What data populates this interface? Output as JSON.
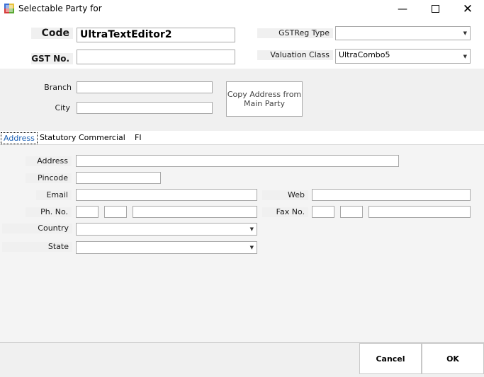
{
  "window": {
    "title": "Selectable Party for"
  },
  "header": {
    "code_label": "Code",
    "code_value": "UltraTextEditor2",
    "gst_no_label": "GST No.",
    "gst_no_value": "",
    "gstreg_type_label": "GSTReg Type",
    "gstreg_type_value": "",
    "valuation_class_label": "Valuation Class",
    "valuation_class_value": "UltraCombo5"
  },
  "branch_section": {
    "branch_label": "Branch",
    "branch_value": "",
    "city_label": "City",
    "city_value": "",
    "copy_button_line1": "Copy Address from",
    "copy_button_line2": "Main Party"
  },
  "tabs": [
    {
      "label": "Address",
      "active": true
    },
    {
      "label": "Statutory",
      "active": false
    },
    {
      "label": "Commercial",
      "active": false
    },
    {
      "label": "FI",
      "active": false
    }
  ],
  "address_tab": {
    "address_label": "Address",
    "pincode_label": "Pincode",
    "email_label": "Email",
    "web_label": "Web",
    "phone_label": "Ph. No.",
    "fax_label": "Fax No.",
    "country_label": "Country",
    "state_label": "State"
  },
  "footer": {
    "cancel_label": "Cancel",
    "ok_label": "OK"
  },
  "colors": {
    "panel": "#f0f0f0",
    "lower_panel": "#f4f4f4",
    "tab_active_text": "#1a5fb4",
    "border": "#a9a9a9"
  }
}
